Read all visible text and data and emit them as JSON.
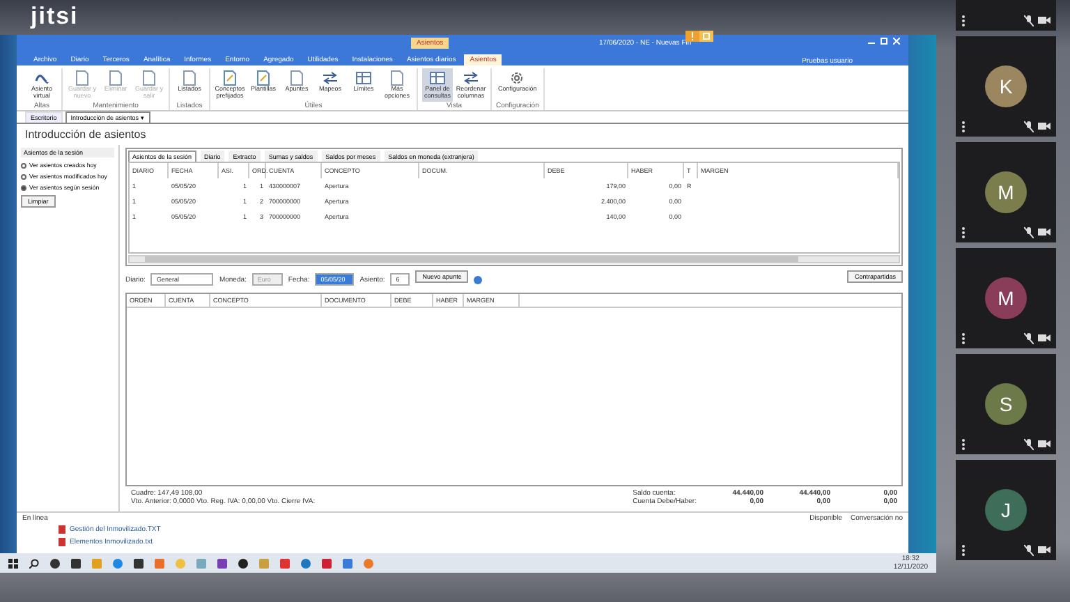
{
  "conference": {
    "logo": "jitsi"
  },
  "app": {
    "title": "17/06/2020 - NE - Nuevas Fin",
    "context_tab": {
      "group": "Asientos",
      "label": "Asientos"
    },
    "menu_tabs": [
      {
        "label": "Archivo",
        "selected": false
      },
      {
        "label": "Diario",
        "selected": false
      },
      {
        "label": "Terceros",
        "selected": false
      },
      {
        "label": "Analítica",
        "selected": false
      },
      {
        "label": "Informes",
        "selected": false
      },
      {
        "label": "Entorno",
        "selected": false
      },
      {
        "label": "Agregado",
        "selected": false
      },
      {
        "label": "Utilidades",
        "selected": false
      },
      {
        "label": "Instalaciones",
        "selected": false
      },
      {
        "label": "Asientos diarios",
        "selected": false
      }
    ],
    "account": "Pruebas usuario",
    "ribbon_groups": [
      {
        "name": "Altas",
        "buttons": [
          {
            "label": "Asiento virtual",
            "kind": "alpha",
            "disabled": false,
            "selected": false
          }
        ]
      },
      {
        "name": "Mantenimiento",
        "buttons": [
          {
            "label": "Guardar y nuevo",
            "kind": "doc",
            "disabled": true,
            "selected": false
          },
          {
            "label": "Eliminar",
            "kind": "doc",
            "disabled": true,
            "selected": false
          },
          {
            "label": "Guardar y salir",
            "kind": "doc",
            "disabled": true,
            "selected": false
          }
        ]
      },
      {
        "name": "Listados",
        "buttons": [
          {
            "label": "Listados",
            "kind": "doc",
            "disabled": false,
            "selected": false
          }
        ]
      },
      {
        "name": "Útiles",
        "buttons": [
          {
            "label": "Conceptos prefijados",
            "kind": "edit",
            "disabled": false,
            "selected": false
          },
          {
            "label": "Plantillas",
            "kind": "edit",
            "disabled": false,
            "selected": false
          },
          {
            "label": "Apuntes",
            "kind": "doc",
            "disabled": false,
            "selected": false
          },
          {
            "label": "Mapeos",
            "kind": "arrows",
            "disabled": false,
            "selected": false
          },
          {
            "label": "Límites",
            "kind": "table",
            "disabled": false,
            "selected": false
          },
          {
            "label": "Más opciones",
            "kind": "doc",
            "disabled": false,
            "selected": false
          }
        ]
      },
      {
        "name": "Vista",
        "buttons": [
          {
            "label": "Panel de consultas",
            "kind": "table",
            "disabled": false,
            "selected": true
          },
          {
            "label": "Reordenar columnas",
            "kind": "arrows",
            "disabled": false,
            "selected": false
          }
        ]
      },
      {
        "name": "Configuración",
        "buttons": [
          {
            "label": "Configuración",
            "kind": "gear",
            "disabled": false,
            "selected": false
          }
        ]
      }
    ],
    "doc_tabs": [
      {
        "label": "Escritorio",
        "selected": false
      },
      {
        "label": "Introducción de asientos ▾",
        "selected": true
      }
    ],
    "heading": "Introducción de asientos",
    "session_panel": {
      "title": "Asientos de la sesión",
      "options": [
        {
          "label": "Ver asientos creados hoy",
          "selected": false
        },
        {
          "label": "Ver asientos modificados hoy",
          "selected": false
        },
        {
          "label": "Ver asientos según sesión",
          "selected": true
        }
      ],
      "button": "Limpiar"
    },
    "grid_tabs": [
      {
        "label": "Asientos de la sesión",
        "selected": true
      },
      {
        "label": "Diario",
        "selected": false
      },
      {
        "label": "Extracto",
        "selected": false
      },
      {
        "label": "Sumas y saldos",
        "selected": false
      },
      {
        "label": "Saldos por meses",
        "selected": false
      },
      {
        "label": "Saldos en moneda (extranjera)",
        "selected": false
      }
    ],
    "session_table": {
      "columns": [
        "DIARIO",
        "FECHA",
        "ASI.",
        "ORD.",
        "CUENTA",
        "CONCEPTO",
        "DOCUM.",
        "DEBE",
        "HABER",
        "T",
        "MARGEN"
      ],
      "rows": [
        [
          "1",
          "05/05/20",
          "1",
          "1",
          "430000007",
          "Apertura",
          null,
          "179,00",
          "0,00",
          "R",
          null
        ],
        [
          "1",
          "05/05/20",
          "1",
          "2",
          "700000000",
          "Apertura",
          null,
          "2.400,00",
          "0,00",
          null,
          null
        ],
        [
          "1",
          "05/05/20",
          "1",
          "3",
          "700000000",
          "Apertura",
          null,
          "140,00",
          "0,00",
          null,
          null
        ]
      ]
    },
    "entry_bar": {
      "diario_label": "Diario:",
      "diario": "General",
      "moneda_label": "Moneda:",
      "moneda": "Euro",
      "fecha_label": "Fecha:",
      "fecha": "05/05/20",
      "asiento_label": "Asiento:",
      "asiento": "6",
      "new_button": "Nuevo apunte",
      "right_button": "Contrapartidas"
    },
    "entry_table": {
      "columns": [
        "ORDEN",
        "CUENTA",
        "CONCEPTO",
        "DOCUMENTO",
        "DEBE",
        "HABER",
        "MARGEN"
      ]
    },
    "summary": {
      "left": [
        "Cuadre: 147,49 108,00",
        "Vto. Anterior: 0,0000  Vto. Reg. IVA: 0,00,00  Vto. Cierre IVA:"
      ],
      "labels": [
        "Saldo cuenta:",
        "Cuenta Debe/Haber:"
      ],
      "values": [
        [
          "44.440,00",
          "44.440,00",
          "0,00"
        ],
        [
          "0,00",
          "0,00",
          "0,00"
        ]
      ]
    },
    "status": {
      "left": "En línea",
      "right": [
        "Disponible",
        "Conversación no"
      ]
    }
  },
  "desktop_files": [
    "Gestión del Inmovilizado.TXT",
    "Elementos Inmovilizado.txt"
  ],
  "taskbar": {
    "time": "18:32",
    "date": "12/11/2020"
  },
  "participants": [
    {
      "letter": "K",
      "color": "#9c8660"
    },
    {
      "letter": "M",
      "color": "#7b7e4c"
    },
    {
      "letter": "M",
      "color": "#8a3d58"
    },
    {
      "letter": "S",
      "color": "#6b7a48"
    },
    {
      "letter": "J",
      "color": "#3e6d5a"
    }
  ]
}
